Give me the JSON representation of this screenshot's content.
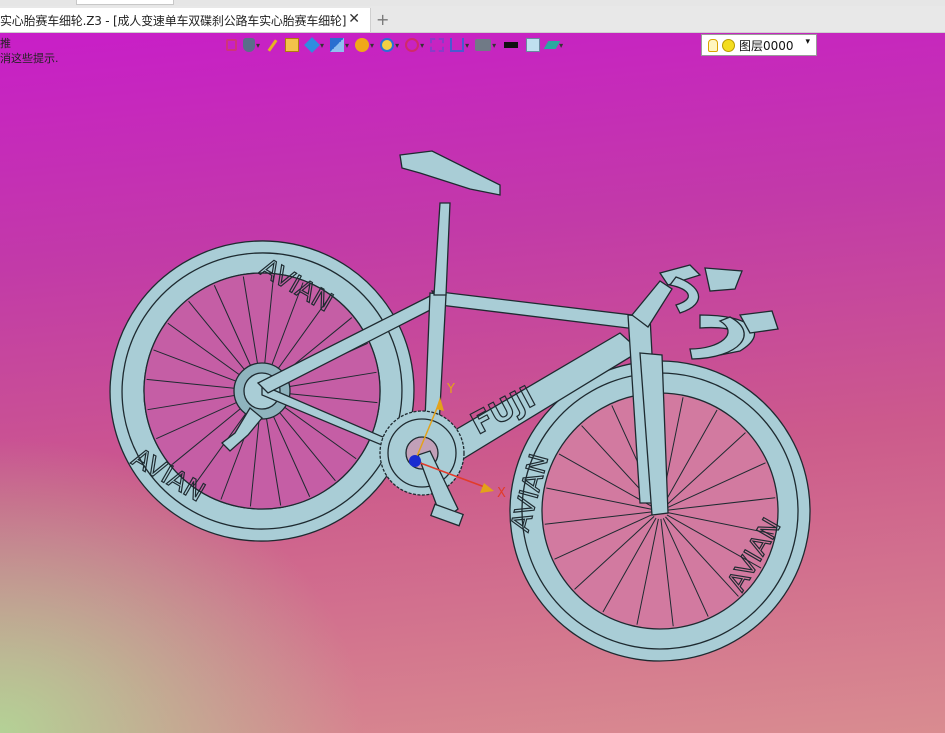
{
  "tab": {
    "title": "实心胎赛车细轮.Z3 - [成人变速单车双碟刹公路车实心胎赛车细轮]",
    "close_glyph": "✕",
    "new_tab_glyph": "+"
  },
  "hints": {
    "line1": "推",
    "line2": "消这些提示."
  },
  "toolbar": {
    "icons": [
      "frame-icon",
      "hand-icon",
      "pen-icon",
      "box-icon",
      "cube-icon",
      "view-cube-icon",
      "sphere-icon",
      "zoom-icon",
      "rotate-icon",
      "fit-icon",
      "crop-icon",
      "display-icon",
      "color-black-icon",
      "color-light-icon",
      "render-icon"
    ]
  },
  "layer": {
    "label": "图层0000",
    "arrow": "▾"
  },
  "axes": {
    "x_label": "X",
    "y_label": "Y"
  },
  "model": {
    "brand_text": "FUJI",
    "rim_text": "AVIAN",
    "colors": {
      "bike": "#a9cdd6",
      "bike_line": "#1e2a30",
      "x_axis": "#e23b2a",
      "y_axis": "#e3a21a"
    }
  }
}
